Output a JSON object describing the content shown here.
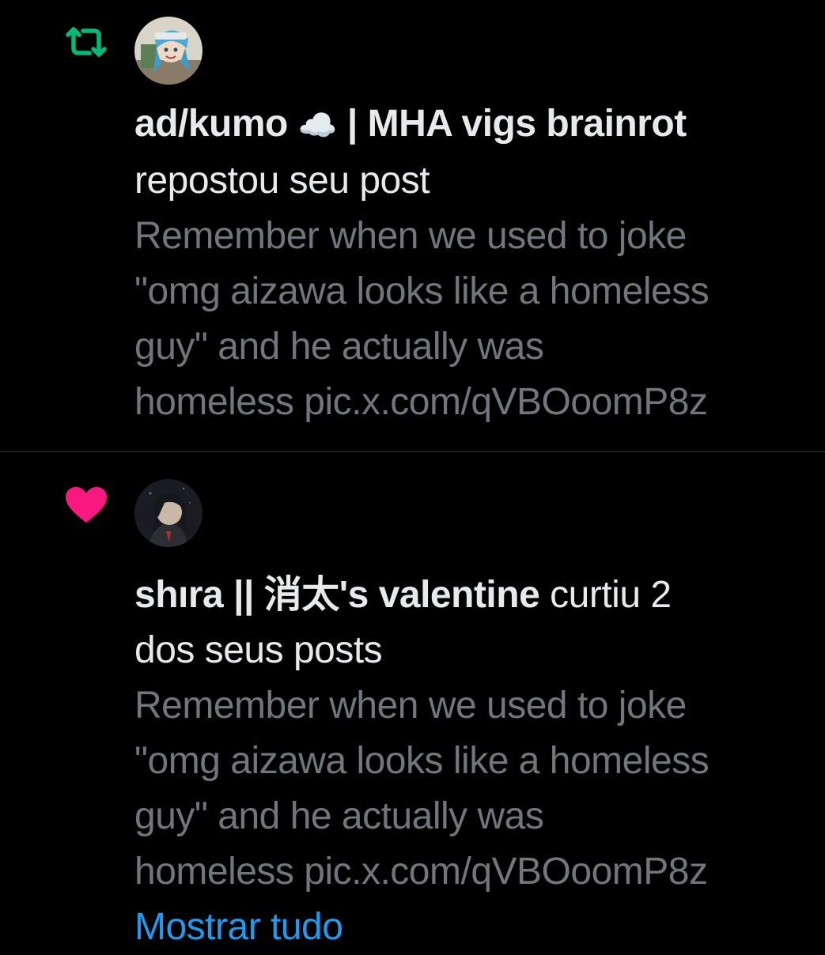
{
  "notifications": [
    {
      "type_icon": "repost-icon",
      "type_color": "#00ba7c",
      "actor_name": "ad/kumo",
      "actor_emoji": "☁️",
      "actor_suffix": " | MHA vigs brainrot",
      "action_line1": " ",
      "action_line2": "repostou seu post",
      "snippet_lines": [
        "Remember when we used to joke",
        "\"omg aizawa looks like a homeless",
        "guy\" and he actually was",
        "homeless pic.x.com/qVBOoomP8z"
      ]
    },
    {
      "type_icon": "heart-icon",
      "type_color": "#f91880",
      "actor_name": "shıra || 消太's valentine",
      "action_inline": " curtiu 2",
      "action_line2": "dos seus posts",
      "snippet_lines": [
        "Remember when we used to joke",
        "\"omg aizawa looks like a homeless",
        "guy\" and he actually was",
        "homeless pic.x.com/qVBOoomP8z"
      ],
      "show_all": "Mostrar tudo"
    }
  ],
  "colors": {
    "background": "#000000",
    "primary_text": "#e7e9ea",
    "secondary_text": "#71767b",
    "link": "#1d9bf0",
    "divider": "#2f3336"
  }
}
